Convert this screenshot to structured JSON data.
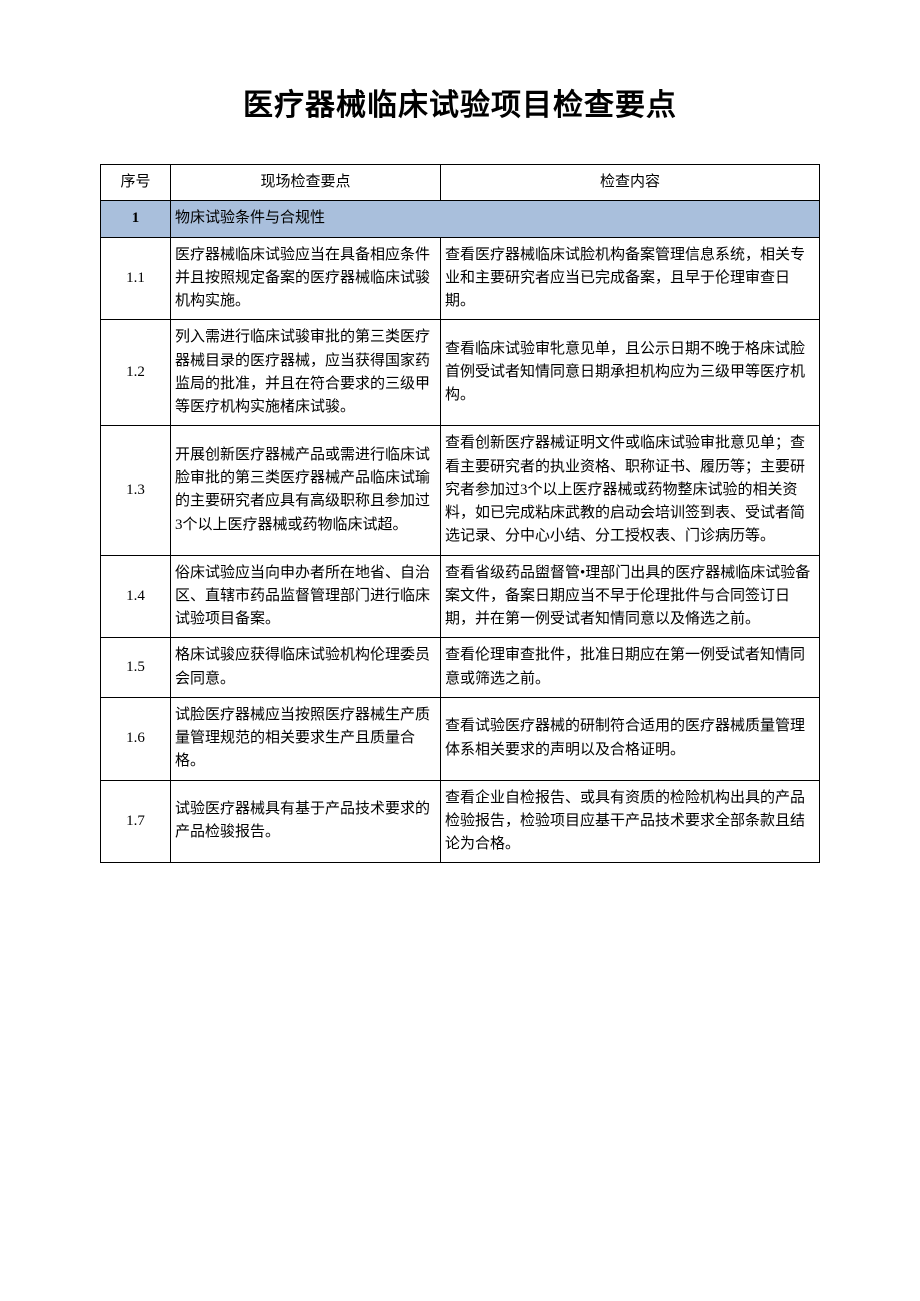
{
  "title": "医疗器械临床试验项目检查要点",
  "headers": {
    "num": "序号",
    "point": "现场检查要点",
    "content": "检查内容"
  },
  "section": {
    "num": "1",
    "label": "物床试验条件与合规性"
  },
  "rows": [
    {
      "num": "1.1",
      "point": "医疗器械临床试验应当在具备相应条件并且按照规定备案的医疗器械临床试骏机构实施。",
      "content": "查看医疗器械临床试脸机构备案管理信息系统，相关专业和主要研究者应当已完成备案，且早于伦理审查日期。"
    },
    {
      "num": "1.2",
      "point": "列入需进行临床试骏审批的第三类医疗器械目录的医疗器械，应当获得国家药监局的批准，并且在符合要求的三级甲等医疗机构实施楮床试骏。",
      "content": "查看临床试验审牝意见单，且公示日期不晚于格床试脸首例受试者知情同意日期承担机构应为三级甲等医疗机构。"
    },
    {
      "num": "1.3",
      "point": "开展创新医疗器械产品或需进行临床试脸审批的第三类医疗器械产品临床试瑜的主要研究者应具有高级职称且参加过3个以上医疗器械或药物临床试超。",
      "content": "查看创新医疗器械证明文件或临床试验审批意见单；查看主要研究者的执业资格、职称证书、履历等；主要研究者参加过3个以上医疗器械或药物整床试验的相关资料，如已完成粘床武教的启动会培训签到表、受试者简选记录、分中心小结、分工授权表、门诊病历等。"
    },
    {
      "num": "1.4",
      "point": "俗床试验应当向申办者所在地省、自治区、直辖市药品监督管理部门进行临床试验项目备案。",
      "content": "查看省级药品盥督管•理部门出具的医疗器械临床试验备案文件，备案日期应当不早于伦理批件与合同签订日期，并在第一例受试者知情同意以及脩选之前。"
    },
    {
      "num": "1.5",
      "point": "格床试骏应获得临床试验机构伦理委员会同意。",
      "content": "查看伦理审查批件，批准日期应在第一例受试者知情同意或筛选之前。"
    },
    {
      "num": "1.6",
      "point": "试脸医疗器械应当按照医疗器械生产质量管理规范的相关要求生产且质量合格。",
      "content": "查看试验医疗器械的研制符合适用的医疗器械质量管理体系相关要求的声明以及合格证明。"
    },
    {
      "num": "1.7",
      "point": "试验医疗器械具有基于产品技术要求的产品检骏报告。",
      "content": "查看企业自检报告、或具有资质的检险机构出具的产品检验报告，检验项目应基干产品技术要求全部条款且结论为合格。"
    }
  ]
}
